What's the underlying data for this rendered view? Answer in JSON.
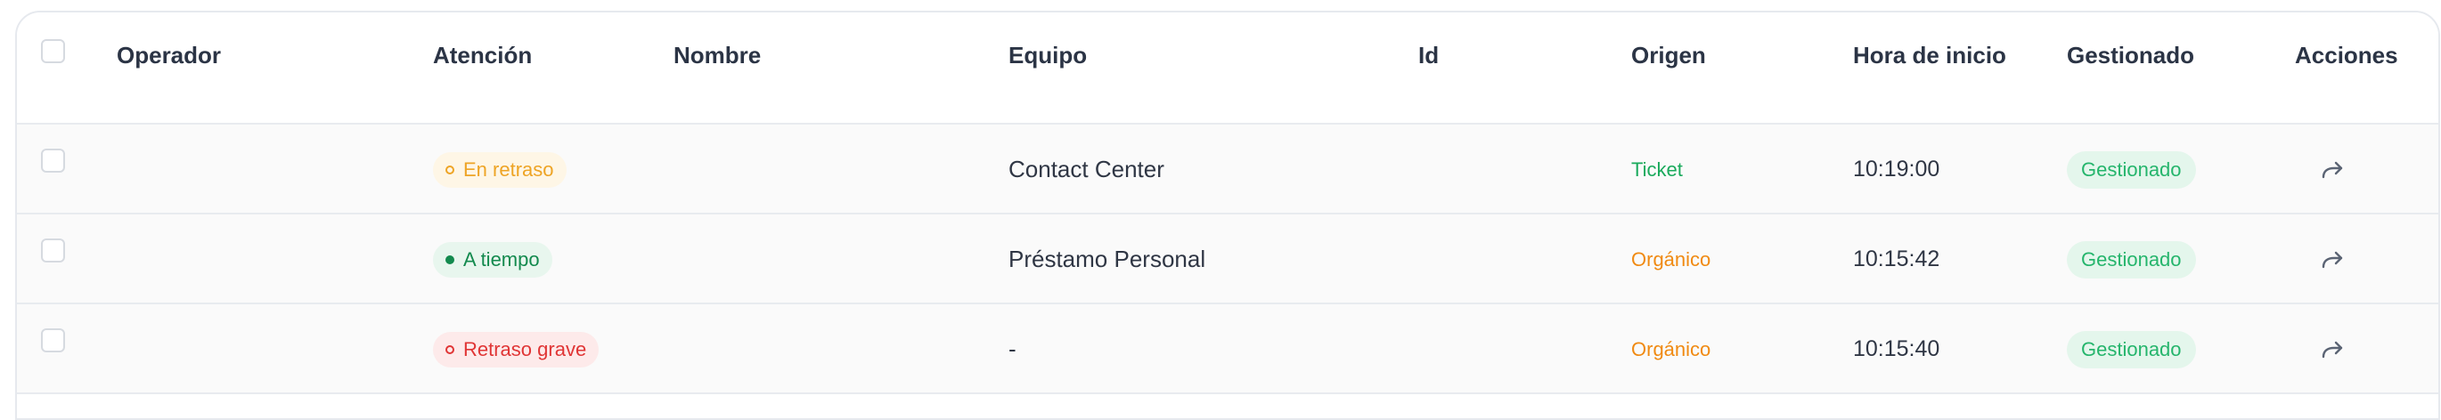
{
  "table": {
    "headers": {
      "operator": "Operador",
      "attention": "Atención",
      "name": "Nombre",
      "team": "Equipo",
      "id": "Id",
      "origin": "Origen",
      "start_time": "Hora de inicio",
      "managed": "Gestionado",
      "actions": "Acciones"
    },
    "rows": [
      {
        "attention": "En retraso",
        "attention_status": "late",
        "team": "Contact Center",
        "origin": "Ticket",
        "origin_color": "#1aaa5c",
        "start_time": "10:19:00",
        "managed": "Gestionado",
        "action_icon": "forward-arrow-icon"
      },
      {
        "attention": "A tiempo",
        "attention_status": "on-time",
        "team": "Préstamo Personal",
        "origin": "Orgánico",
        "origin_color": "#f08a12",
        "start_time": "10:15:42",
        "managed": "Gestionado",
        "action_icon": "forward-arrow-icon"
      },
      {
        "attention": "Retraso grave",
        "attention_status": "severe",
        "team": "-",
        "origin": "Orgánico",
        "origin_color": "#f08a12",
        "start_time": "10:15:40",
        "managed": "Gestionado",
        "action_icon": "forward-arrow-icon"
      }
    ]
  },
  "colors": {
    "late": "#eea425",
    "on_time": "#138a4e",
    "severe": "#e03535",
    "managed": "#25b56c"
  }
}
